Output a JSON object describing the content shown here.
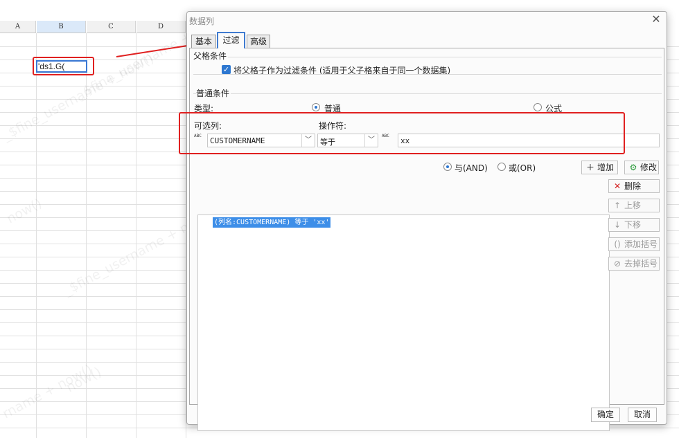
{
  "sheet": {
    "columns": [
      "A",
      "B",
      "C",
      "D"
    ],
    "cell_editor_text": "'ds1.G(",
    "watermarks": [
      "_$fine_username + now()",
      "now()",
      "_$fine_username + now()",
      "_$fine_username + now()",
      "rname + now()",
      "now()"
    ]
  },
  "dialog": {
    "title": "数据列",
    "close_glyph": "✕",
    "tabs": [
      {
        "label": "基本"
      },
      {
        "label": "过滤"
      },
      {
        "label": "高级"
      }
    ],
    "parent_section": {
      "title": "父格条件",
      "checkbox_label": "将父格子作为过滤条件 (适用于父子格来自于同一个数据集)",
      "checked": true
    },
    "normal_section": {
      "title": "普通条件",
      "type_label": "类型:",
      "type_options": [
        "普通",
        "公式"
      ],
      "type_selected": "普通",
      "column_label": "可选列:",
      "column_value": "CUSTOMERNAME",
      "operator_label": "操作符:",
      "operator_value": "等于",
      "value_input": "xx",
      "abc_icon_text": "ABC"
    },
    "logic": {
      "and_label": "与(AND)",
      "or_label": "或(OR)",
      "selected": "and"
    },
    "add_button": "增加",
    "modify_button": "修改",
    "conditions": [
      "(列名:CUSTOMERNAME) 等于 'xx'"
    ],
    "side_buttons": [
      {
        "label": "删除",
        "icon": "delete-icon",
        "glyph": "✕",
        "enabled": true
      },
      {
        "label": "上移",
        "icon": "arrow-up-icon",
        "glyph": "↑",
        "enabled": false
      },
      {
        "label": "下移",
        "icon": "arrow-down-icon",
        "glyph": "↓",
        "enabled": false
      },
      {
        "label": "添加括号",
        "icon": "bracket-add-icon",
        "glyph": "()",
        "enabled": false
      },
      {
        "label": "去掉括号",
        "icon": "bracket-remove-icon",
        "glyph": "⊘",
        "enabled": false
      }
    ],
    "ok_button": "确定",
    "cancel_button": "取消"
  },
  "colors": {
    "annotation_red": "#e02020",
    "accent_blue": "#2d77d0",
    "selection_blue": "#3d8ee8"
  }
}
